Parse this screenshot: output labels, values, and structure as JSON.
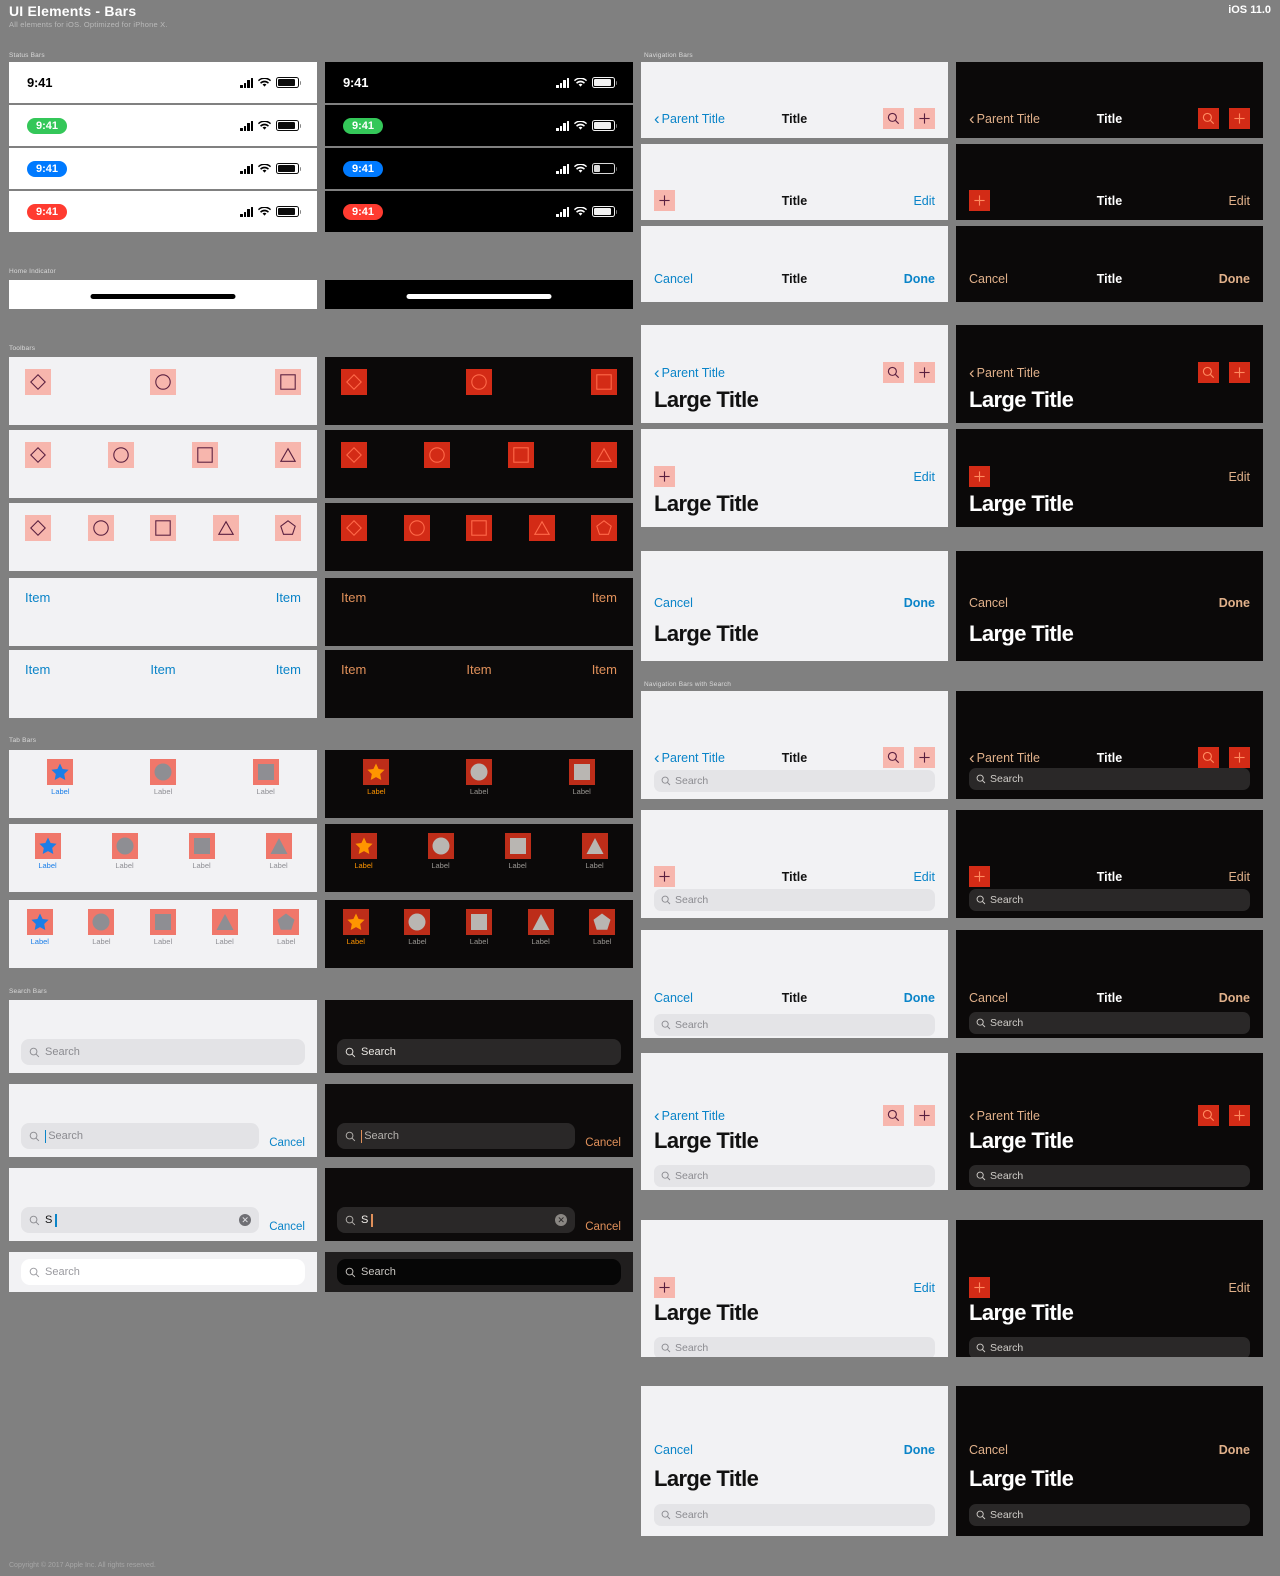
{
  "header": {
    "title": "UI Elements - Bars",
    "subtitle": "All elements for iOS. Optimized for iPhone X.",
    "version": "iOS 11.0",
    "copyright": "Copyright © 2017 Apple Inc. All rights reserved."
  },
  "sections": {
    "status_bars": "Status Bars",
    "home_indicator": "Home Indicator",
    "toolbars": "Toolbars",
    "tab_bars": "Tab Bars",
    "search_bars": "Search Bars",
    "navigation_bars": "Navigation Bars",
    "navigation_bars_search": "Navigation Bars with Search"
  },
  "colors": {
    "page_bg": "#808080",
    "light_panel": "#f2f2f4",
    "dark_panel": "#0b0909",
    "tint_light": "#0a84c8",
    "tint_dark": "#e0905a",
    "accent_box_light": "#f7b6ad",
    "accent_box_dark": "#d32b16",
    "pill_green": "#34c759",
    "pill_blue": "#007aff",
    "pill_red": "#ff3b30",
    "tab_active_light": "#1a7ee8",
    "tab_active_dark": "#ff9500",
    "tab_inactive": "#8e8e93"
  },
  "status_bars": {
    "time": "9:41",
    "rows": [
      {
        "style": "plain",
        "theme": "light"
      },
      {
        "style": "pill",
        "theme": "light",
        "pill_color": "#34c759"
      },
      {
        "style": "pill",
        "theme": "light",
        "pill_color": "#007aff"
      },
      {
        "style": "pill",
        "theme": "light",
        "pill_color": "#ff3b30"
      }
    ],
    "dark_rows": [
      {
        "style": "plain",
        "theme": "dark"
      },
      {
        "style": "pill",
        "theme": "dark",
        "pill_color": "#34c759"
      },
      {
        "style": "pill",
        "theme": "dark",
        "pill_color": "#007aff"
      },
      {
        "style": "pill",
        "theme": "dark",
        "pill_color": "#ff3b30"
      }
    ],
    "icons": [
      "signal-bars-icon",
      "wifi-icon",
      "battery-icon"
    ]
  },
  "toolbars": {
    "item_label": "Item",
    "shape_rows": [
      {
        "shapes": [
          "diamond",
          "circle",
          "square"
        ],
        "layout": "spread"
      },
      {
        "shapes": [
          "diamond",
          "circle",
          "square",
          "triangle"
        ],
        "layout": "spread"
      },
      {
        "shapes": [
          "diamond",
          "circle",
          "square",
          "triangle",
          "pentagon"
        ],
        "layout": "spread"
      }
    ],
    "item_rows": [
      {
        "items": [
          "Item",
          "Item"
        ]
      },
      {
        "items": [
          "Item",
          "Item",
          "Item"
        ]
      }
    ]
  },
  "tab_bars": {
    "label": "Label",
    "rows": [
      {
        "count": 3,
        "shapes": [
          "star",
          "circle",
          "square"
        ]
      },
      {
        "count": 4,
        "shapes": [
          "star",
          "circle",
          "square",
          "triangle"
        ]
      },
      {
        "count": 5,
        "shapes": [
          "star",
          "circle",
          "square",
          "triangle",
          "pentagon"
        ]
      }
    ]
  },
  "search_bars": {
    "placeholder": "Search",
    "cancel_label": "Cancel",
    "typed_value": "S",
    "rows": [
      {
        "state": "inactive",
        "has_cancel": false,
        "has_clear": false,
        "variant": "inset"
      },
      {
        "state": "focused-empty",
        "has_cancel": true,
        "has_clear": false,
        "variant": "inset"
      },
      {
        "state": "typed",
        "has_cancel": true,
        "has_clear": true,
        "variant": "inset"
      },
      {
        "state": "inactive",
        "has_cancel": false,
        "has_clear": false,
        "variant": "pill"
      }
    ]
  },
  "navigation_bars": {
    "parent_title": "Parent Title",
    "title": "Title",
    "large_title": "Large Title",
    "edit_label": "Edit",
    "cancel_label": "Cancel",
    "done_label": "Done",
    "search_placeholder": "Search",
    "rows": [
      {
        "kind": "standard",
        "left": "back",
        "center": "Title",
        "right": [
          "search-icon",
          "plus-icon"
        ]
      },
      {
        "kind": "standard",
        "left": "plus",
        "center": "Title",
        "right": [
          "Edit"
        ]
      },
      {
        "kind": "standard",
        "left": "Cancel",
        "center": "Title",
        "right": [
          "Done"
        ]
      },
      {
        "kind": "large",
        "left": "back",
        "title": "Large Title",
        "right": [
          "search-icon",
          "plus-icon"
        ]
      },
      {
        "kind": "large",
        "left": "plus",
        "title": "Large Title",
        "right": [
          "Edit"
        ]
      },
      {
        "kind": "large",
        "left": "Cancel",
        "title": "Large Title",
        "right": [
          "Done"
        ]
      }
    ],
    "search_rows": [
      {
        "kind": "standard",
        "left": "back",
        "center": "Title",
        "right": [
          "search-icon",
          "plus-icon"
        ]
      },
      {
        "kind": "standard",
        "left": "plus",
        "center": "Title",
        "right": [
          "Edit"
        ]
      },
      {
        "kind": "standard",
        "left": "Cancel",
        "center": "Title",
        "right": [
          "Done"
        ]
      },
      {
        "kind": "large",
        "left": "back",
        "title": "Large Title",
        "right": [
          "search-icon",
          "plus-icon"
        ]
      },
      {
        "kind": "large",
        "left": "plus",
        "title": "Large Title",
        "right": [
          "Edit"
        ]
      },
      {
        "kind": "large",
        "left": "Cancel",
        "title": "Large Title",
        "right": [
          "Done"
        ]
      }
    ]
  }
}
